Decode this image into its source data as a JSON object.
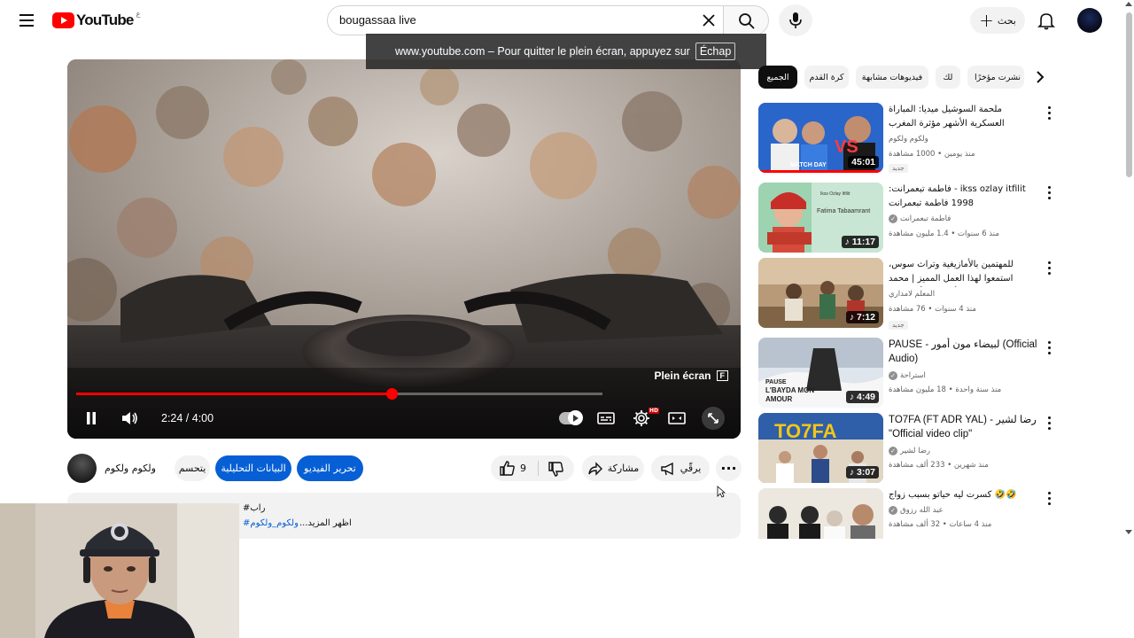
{
  "header": {
    "logo_text": "YouTube",
    "logo_country": "ع",
    "search_value": "bougassaa live",
    "create_label": "بحث",
    "colors": {
      "brand": "#ff0000",
      "link": "#065fd4"
    }
  },
  "fullscreen_toast": {
    "text": "www.youtube.com – Pour quitter le plein écran, appuyez sur",
    "key": "Échap"
  },
  "player": {
    "fullscreen_hint": "Plein écran",
    "fullscreen_key": "F",
    "time": "2:24 / 4:00",
    "progress": 0.6,
    "hd_badge": "HD",
    "icons": [
      "pause-icon",
      "volume-icon",
      "autoplay-toggle",
      "subtitles-icon",
      "settings-icon",
      "miniplayer-icon",
      "fullscreen-icon"
    ]
  },
  "channel": {
    "name": "ولكوم ولكوم",
    "customize_label": "يتحسم",
    "analytics_label": "البيانات التحليلية",
    "edit_label": "تحرير الفيديو",
    "like_count": "9",
    "share_label": "مشاركة",
    "promote_label": "يرقّي"
  },
  "description": {
    "tag_line": "#راب",
    "hashtag": "#ولكوم_ولكوم",
    "more_label": "...اظهر المزيد"
  },
  "chips": [
    {
      "label": "الجميع",
      "active": true
    },
    {
      "label": "كرة القدم",
      "active": false
    },
    {
      "label": "فيديوهات مشابهة",
      "active": false
    },
    {
      "label": "لك",
      "active": false
    },
    {
      "label": "نشرت مؤخرًا",
      "active": false
    }
  ],
  "recommendations": [
    {
      "title": "ملحمة السوشيل ميديا: المباراة العسكرية الأشهر مؤثرة المغرب",
      "channel": "ولكوم ولكوم",
      "verified": false,
      "meta": "منذ يومين • 1000 مشاهدة",
      "badge": "جديد",
      "duration": "45:01",
      "watched": true,
      "thumb_colors": [
        "#1e6fd1",
        "#d9e6f5",
        "#2a2a2a"
      ]
    },
    {
      "title": "ikss ozlay itfilit - فاطمة تبعمرانت: 1998 فاطمة تبعمرانت",
      "channel": "فاطمة تبعمرانت",
      "verified": true,
      "meta": "منذ 6 سنوات • 1.4 مليون مشاهدة",
      "badge": "",
      "duration": "11:17",
      "watched": false,
      "thumb_colors": [
        "#8fc7a3",
        "#c83a2f",
        "#f4d9c9"
      ]
    },
    {
      "title": "للمهتمين بالأمازيغية وتراث سوس، استمعوا لهذا العمل المميز | محمد أمركشي أبوتوازي!",
      "channel": "المعلم لامداري",
      "verified": false,
      "meta": "منذ 4 سنوات • 76 مشاهدة",
      "badge": "جديد",
      "duration": "7:12",
      "watched": false,
      "thumb_colors": [
        "#8a6b4a",
        "#c9a57a",
        "#5a4530"
      ]
    },
    {
      "title": "PAUSE - لبيضاء مون أمور (Official Audio)",
      "channel": "استراحة",
      "verified": true,
      "meta": "منذ سنة واحدة • 18 مليون مشاهدة",
      "badge": "",
      "duration": "4:49",
      "watched": false,
      "thumb_colors": [
        "#d8dde3",
        "#f0f0f0",
        "#2a2a2a"
      ]
    },
    {
      "title": "TO7FA (FT ADR YAL) - رضا لشير \"Official video clip\"",
      "channel": "رضا لشير",
      "verified": true,
      "meta": "منذ شهرين • 233 ألف مشاهدة",
      "badge": "",
      "duration": "3:07",
      "watched": false,
      "thumb_colors": [
        "#f2c618",
        "#1f5fb8",
        "#e9e1d3"
      ]
    },
    {
      "title": "🤣🤣 كسرت ليه حياتو بسبب زواج",
      "channel": "عبد الله رزوق",
      "verified": true,
      "meta": "منذ 4 ساعات • 32 ألف مشاهدة",
      "badge": "",
      "duration": "",
      "watched": false,
      "thumb_colors": [
        "#e9e4dc",
        "#2a2a2a",
        "#f0f0f0"
      ]
    }
  ]
}
